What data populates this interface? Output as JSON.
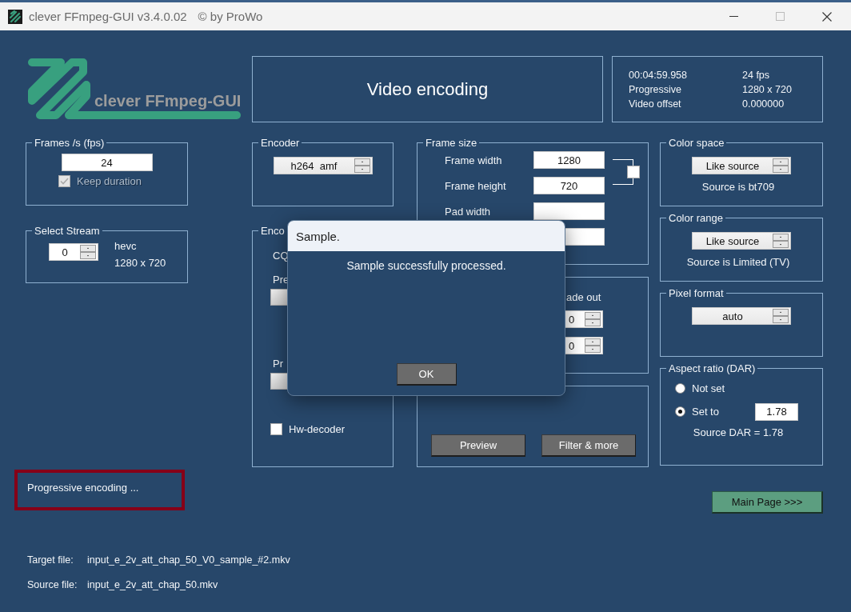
{
  "window": {
    "title": "clever FFmpeg-GUI v3.4.0.02",
    "copyright": "© by ProWo"
  },
  "logo": {
    "text": "clever FFmpeg-GUI"
  },
  "heading": "Video encoding",
  "info": [
    {
      "label": "00:04:59.958",
      "value": "24 fps"
    },
    {
      "label": "Progressive",
      "value": "1280 x 720"
    },
    {
      "label": "Video offset",
      "value": "0.000000"
    }
  ],
  "frames": {
    "title": "Frames /s (fps)",
    "value": "24",
    "keep_duration": {
      "label": "Keep duration",
      "checked": true,
      "disabled": true
    }
  },
  "stream": {
    "title": "Select Stream",
    "value": "0",
    "codec": "hevc",
    "size": "1280 x 720"
  },
  "encoder": {
    "title": "Encoder",
    "value": "h264  amf"
  },
  "encoder_settings": {
    "title": "Enco",
    "labels": [
      "CQ",
      "Pre",
      "Pr"
    ],
    "hw_decoder": {
      "label": "Hw-decoder",
      "checked": false
    }
  },
  "frame_size": {
    "title": "Frame size",
    "fields": [
      {
        "label": "Frame width",
        "value": "1280"
      },
      {
        "label": "Frame height",
        "value": "720"
      },
      {
        "label": "Pad width"
      }
    ],
    "keep_ratio": {
      "checked": false
    }
  },
  "fade": {
    "label": "ade out",
    "values": [
      "0",
      "0"
    ]
  },
  "buttons": [
    "Preview",
    "Filter & more"
  ],
  "color_space": {
    "title": "Color space",
    "value": "Like source",
    "note": "Source is bt709"
  },
  "color_range": {
    "title": "Color range",
    "value": "Like source",
    "note": "Source is Limited (TV)"
  },
  "pixel_format": {
    "title": "Pixel format",
    "value": "auto"
  },
  "aspect": {
    "title": "Aspect ratio (DAR)",
    "options": [
      {
        "label": "Not set",
        "selected": false
      },
      {
        "label": "Set to",
        "selected": true
      }
    ],
    "value": "1.78",
    "note": "Source DAR = 1.78"
  },
  "status": "Progressive encoding ...",
  "main_button": "Main Page >>>",
  "files": [
    {
      "label": "Target file:",
      "value": "input_e_2v_att_chap_50_V0_sample_#2.mkv"
    },
    {
      "label": "Source file:",
      "value": "input_e_2v_att_chap_50.mkv"
    }
  ],
  "dialog": {
    "title": "Sample.",
    "message": "Sample successfully processed.",
    "button": "OK"
  }
}
